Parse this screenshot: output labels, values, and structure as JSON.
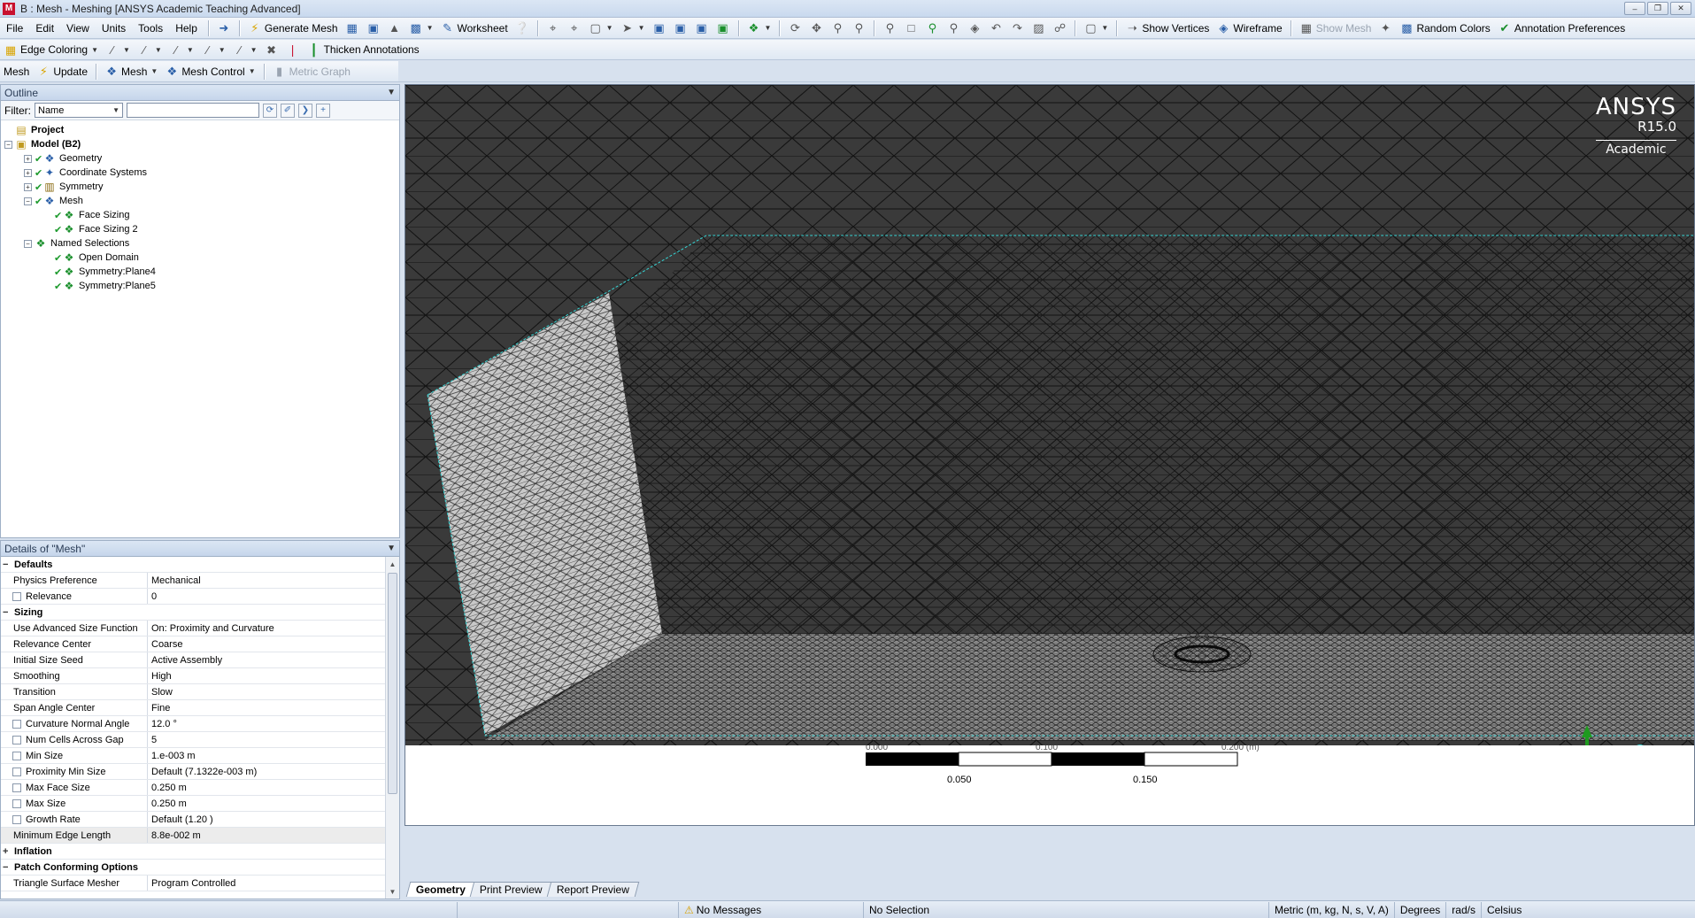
{
  "window": {
    "title": "B : Mesh - Meshing [ANSYS Academic Teaching Advanced]",
    "app_icon_letter": "M",
    "minimize": "–",
    "restore": "❐",
    "close": "✕"
  },
  "menu": {
    "items": [
      "File",
      "Edit",
      "View",
      "Units",
      "Tools",
      "Help"
    ],
    "generate_mesh": "Generate Mesh",
    "worksheet": "Worksheet",
    "show_vertices": "Show Vertices",
    "wireframe": "Wireframe",
    "show_mesh": "Show Mesh",
    "random_colors": "Random Colors",
    "annotation_preferences": "Annotation Preferences"
  },
  "toolbar2": {
    "edge_coloring": "Edge Coloring",
    "thicken_annotations": "Thicken Annotations"
  },
  "toolbar3": {
    "context_label": "Mesh",
    "update": "Update",
    "mesh_menu": "Mesh",
    "mesh_control": "Mesh Control",
    "metric_graph": "Metric Graph"
  },
  "outline": {
    "header": "Outline",
    "filter_label": "Filter:",
    "filter_value": "Name",
    "tree": [
      {
        "label": "Project",
        "level": 0,
        "bold": true,
        "expander": "",
        "check": false,
        "icon": "project-icon"
      },
      {
        "label": "Model (B2)",
        "level": 0,
        "bold": true,
        "expander": "−",
        "check": false,
        "icon": "model-icon"
      },
      {
        "label": "Geometry",
        "level": 1,
        "bold": false,
        "expander": "+",
        "check": true,
        "icon": "geometry-icon"
      },
      {
        "label": "Coordinate Systems",
        "level": 1,
        "bold": false,
        "expander": "+",
        "check": true,
        "icon": "coordinate-systems-icon"
      },
      {
        "label": "Symmetry",
        "level": 1,
        "bold": false,
        "expander": "+",
        "check": true,
        "icon": "symmetry-icon"
      },
      {
        "label": "Mesh",
        "level": 1,
        "bold": false,
        "expander": "−",
        "check": true,
        "icon": "mesh-icon"
      },
      {
        "label": "Face Sizing",
        "level": 2,
        "bold": false,
        "expander": "",
        "check": true,
        "icon": "face-sizing-icon"
      },
      {
        "label": "Face Sizing 2",
        "level": 2,
        "bold": false,
        "expander": "",
        "check": true,
        "icon": "face-sizing-icon"
      },
      {
        "label": "Named Selections",
        "level": 1,
        "bold": false,
        "expander": "−",
        "check": false,
        "icon": "named-selections-icon"
      },
      {
        "label": "Open Domain",
        "level": 2,
        "bold": false,
        "expander": "",
        "check": true,
        "icon": "named-selection-icon"
      },
      {
        "label": "Symmetry:Plane4",
        "level": 2,
        "bold": false,
        "expander": "",
        "check": true,
        "icon": "named-selection-icon"
      },
      {
        "label": "Symmetry:Plane5",
        "level": 2,
        "bold": false,
        "expander": "",
        "check": true,
        "icon": "named-selection-icon"
      }
    ]
  },
  "details": {
    "header": "Details of \"Mesh\"",
    "rows": [
      {
        "type": "group",
        "label": "Defaults",
        "exp": "−"
      },
      {
        "type": "prop",
        "label": "Physics Preference",
        "value": "Mechanical",
        "cb": false
      },
      {
        "type": "prop",
        "label": "Relevance",
        "value": "0",
        "cb": true
      },
      {
        "type": "group",
        "label": "Sizing",
        "exp": "−"
      },
      {
        "type": "prop",
        "label": "Use Advanced Size Function",
        "value": "On: Proximity and Curvature",
        "cb": false
      },
      {
        "type": "prop",
        "label": "Relevance Center",
        "value": "Coarse",
        "cb": false
      },
      {
        "type": "prop",
        "label": "Initial Size Seed",
        "value": "Active Assembly",
        "cb": false
      },
      {
        "type": "prop",
        "label": "Smoothing",
        "value": "High",
        "cb": false
      },
      {
        "type": "prop",
        "label": "Transition",
        "value": "Slow",
        "cb": false
      },
      {
        "type": "prop",
        "label": "Span Angle Center",
        "value": "Fine",
        "cb": false
      },
      {
        "type": "prop",
        "label": "Curvature Normal Angle",
        "value": "12.0 °",
        "cb": true
      },
      {
        "type": "prop",
        "label": "Num Cells Across Gap",
        "value": "5",
        "cb": true
      },
      {
        "type": "prop",
        "label": "Min Size",
        "value": "1.e-003 m",
        "cb": true
      },
      {
        "type": "prop",
        "label": "Proximity Min Size",
        "value": "Default (7.1322e-003 m)",
        "cb": true
      },
      {
        "type": "prop",
        "label": "Max Face Size",
        "value": "0.250 m",
        "cb": true
      },
      {
        "type": "prop",
        "label": "Max Size",
        "value": "0.250 m",
        "cb": true
      },
      {
        "type": "prop",
        "label": "Growth Rate",
        "value": "Default (1.20 )",
        "cb": true
      },
      {
        "type": "prop",
        "label": "Minimum Edge Length",
        "value": "8.8e-002 m",
        "cb": false,
        "highlight": true
      },
      {
        "type": "group",
        "label": "Inflation",
        "exp": "+"
      },
      {
        "type": "group",
        "label": "Patch Conforming Options",
        "exp": "−"
      },
      {
        "type": "prop",
        "label": "Triangle Surface Mesher",
        "value": "Program Controlled",
        "cb": false
      }
    ]
  },
  "viewport": {
    "logo_line1": "ANSYS",
    "logo_line2": "R15.0",
    "logo_line3": "Academic",
    "scale_labels": [
      "0.000",
      "0.100",
      "0.200 (m)"
    ],
    "scale_sub_labels": [
      "0.050",
      "0.150"
    ]
  },
  "tabs": [
    "Geometry",
    "Print Preview",
    "Report Preview"
  ],
  "status": {
    "messages": "No Messages",
    "selection": "No Selection",
    "units": "Metric (m, kg, N, s, V, A)",
    "angle": "Degrees",
    "angular_velocity": "rad/s",
    "temperature": "Celsius"
  },
  "colors": {
    "viewport_bg": "#3a3a3a",
    "mesh_line": "#111111",
    "face_light": "#c8c8c8",
    "edge_cyan": "#35d4d4",
    "triad_x": "#d21f1f",
    "triad_y": "#1f9a1f",
    "triad_z": "#2030c8"
  }
}
